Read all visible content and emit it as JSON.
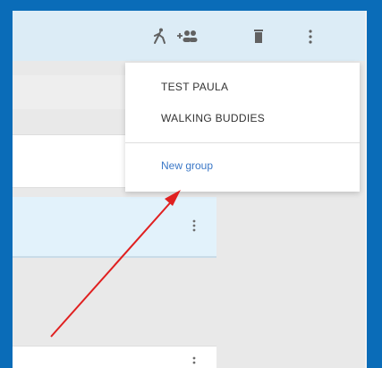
{
  "toolbar": {
    "icons": [
      "walk-icon",
      "group-add-icon",
      "trash-icon",
      "more-vert-icon"
    ]
  },
  "menu": {
    "items": [
      "TEST PAULA",
      "WALKING BUDDIES"
    ],
    "new_group_label": "New group"
  },
  "colors": {
    "page_border": "#0a6cb8",
    "toolbar_bg": "#dcecf6",
    "selected_row_bg": "#e2f2fb",
    "link": "#3b78c7",
    "annotation_arrow": "#e02020"
  }
}
